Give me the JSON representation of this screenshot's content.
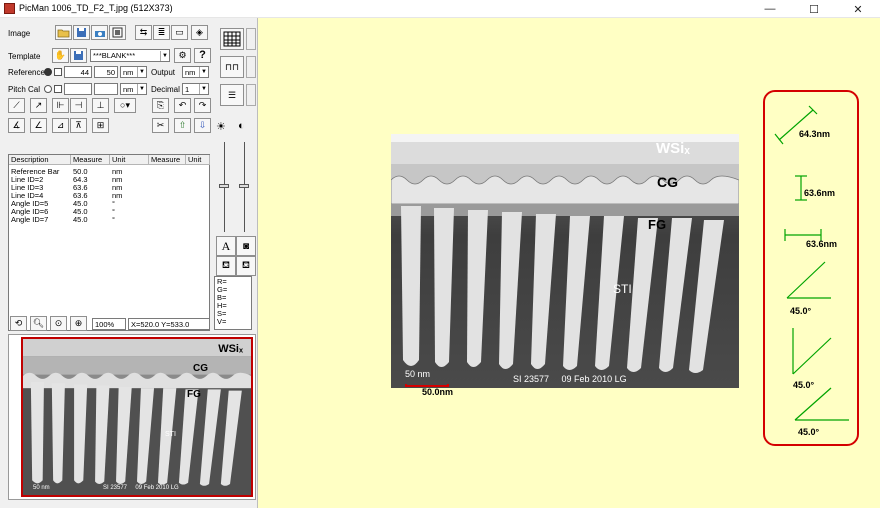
{
  "window": {
    "title": "PicMan 1006_TD_F2_T.jpg  (512X373)",
    "minimize": "—",
    "maximize": "☐",
    "close": "✕"
  },
  "panel": {
    "image_label": "Image",
    "template_label": "Template",
    "template_value": "***BLANK***",
    "reference_label": "Reference",
    "reference_px": "44",
    "reference_len": "50",
    "reference_unit": "nm",
    "output_label": "Output",
    "output_unit": "nm",
    "pitch_label": "Pitch Cal",
    "pitch_unit": "nm",
    "decimal_label": "Decimal",
    "decimal_value": "1",
    "text_tool": "A",
    "zoom": "100%",
    "coords": "X=520.0 Y=533.0",
    "color_readouts": [
      "R=",
      "G=",
      "B=",
      "H=",
      "S=",
      "V="
    ]
  },
  "table": {
    "headers": [
      "Description",
      "Measure",
      "Unit",
      "Measure",
      "Unit"
    ],
    "rows": [
      {
        "desc": "Reference Bar",
        "measure": "50.0",
        "unit": "nm"
      },
      {
        "desc": "Line ID=2",
        "measure": "64.3",
        "unit": "nm"
      },
      {
        "desc": "Line ID=3",
        "measure": "63.6",
        "unit": "nm"
      },
      {
        "desc": "Line ID=4",
        "measure": "63.6",
        "unit": "nm"
      },
      {
        "desc": "Angle ID=5",
        "measure": "45.0",
        "unit": "°"
      },
      {
        "desc": "Angle ID=6",
        "measure": "45.0",
        "unit": "°"
      },
      {
        "desc": "Angle ID=7",
        "measure": "45.0",
        "unit": "°"
      }
    ]
  },
  "image": {
    "labels": {
      "wsi": "WSiₓ",
      "cg": "CG",
      "fg": "FG",
      "sti": "STI"
    },
    "scale_text": "50 nm",
    "info_text": "SI 23577     09 Feb 2010 LG",
    "ref_bar_label": "50.0nm",
    "thumb_scale_text": "50 nm",
    "thumb_info_text": "SI 23577     09 Feb 2010 LG"
  },
  "annotations": [
    "64.3nm",
    "63.6nm",
    "63.6nm",
    "45.0°",
    "45.0°",
    "45.0°"
  ],
  "colors": {
    "viewport_bg": "#ffffc4",
    "annotation_green": "#00a400",
    "callout_red": "#d40000",
    "thumb_border": "#c00000"
  }
}
